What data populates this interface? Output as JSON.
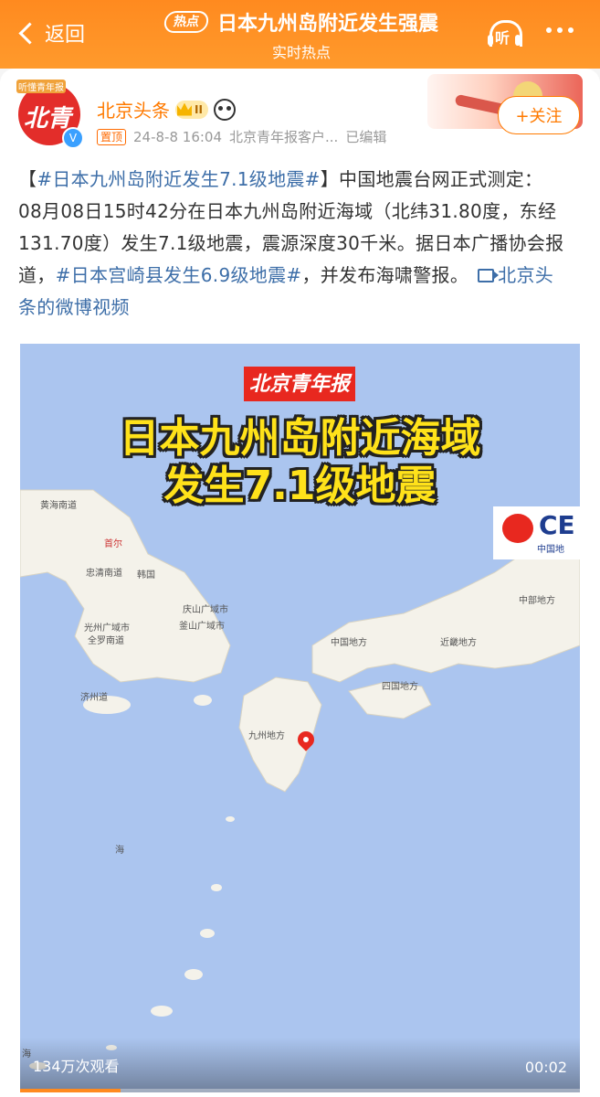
{
  "header": {
    "back_label": "返回",
    "hot_tag": "热点",
    "title": "日本九州岛附近发生强震",
    "subtitle": "实时热点",
    "listen_label": "听",
    "more_icon": "more-dots-icon"
  },
  "post": {
    "avatar_tag": "听懂青年报",
    "avatar_logo": "北青",
    "author": "北京头条",
    "rank_level": "II",
    "pinned_label": "置顶",
    "date": "24-8-8 16:04",
    "source": "北京青年报客户...",
    "edited": "已编辑",
    "follow_label": "+关注",
    "text": {
      "bracket_open": "【",
      "tag1": "#日本九州岛附近发生7.1级地震#",
      "bracket_close": "】",
      "part1": "中国地震台网正式测定：08月08日15时42分在日本九州岛附近海域（北纬31.80度，东经131.70度）发生7.1级地震，震源深度30千米。据日本广播协会报道，",
      "tag2": "#日本宫崎县发生6.9级地震#",
      "part2": "，并发布海啸警报。",
      "video_link": "北京头条的微博视频"
    }
  },
  "video": {
    "paper_name": "北京青年报",
    "headline_line1": "日本九州岛附近海域",
    "headline_line2": "发生7.1级地震",
    "cenc_logo": "CE",
    "cenc_sub": "中国地",
    "map_labels": [
      "黄海南道",
      "首尔",
      "忠清南道",
      "韩国",
      "庆山广域市",
      "光州广域市",
      "全罗南道",
      "釜山广域市",
      "济州道",
      "中国地方",
      "近畿地方",
      "中部地方",
      "四国地方",
      "九州地方",
      "海",
      "海"
    ],
    "views": "134万次观看",
    "duration": "00:02",
    "progress_fraction": 0.18
  },
  "colors": {
    "accent": "#ff8a1f",
    "link": "#3d6ea8",
    "author": "#ff7a00",
    "sea": "#abc5ef",
    "land": "#f4f2ea",
    "epicenter": "#e8281f"
  }
}
